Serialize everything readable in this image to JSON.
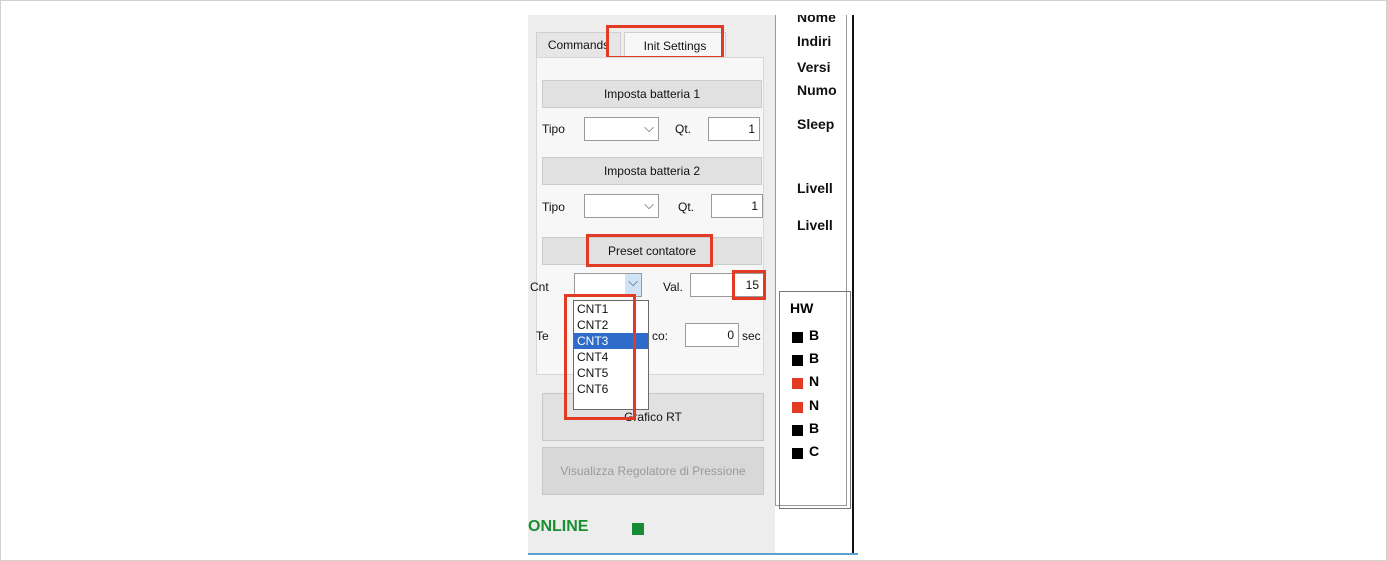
{
  "tabs": {
    "commands": "Commands",
    "init_settings": "Init Settings"
  },
  "battery1": {
    "button": "Imposta batteria 1",
    "tipo_label": "Tipo",
    "qt_label": "Qt.",
    "qt_value": "1"
  },
  "battery2": {
    "button": "Imposta batteria 2",
    "tipo_label": "Tipo",
    "qt_label": "Qt.",
    "qt_value": "1"
  },
  "preset": {
    "button": "Preset contatore",
    "cnt_label": "Cnt",
    "val_label": "Val.",
    "val_value": "15"
  },
  "dropdown": {
    "options": [
      "CNT1",
      "CNT2",
      "CNT3",
      "CNT4",
      "CNT5",
      "CNT6"
    ],
    "selected": "CNT3"
  },
  "timer": {
    "label_left": "Te",
    "label_right": "co:",
    "value": "0",
    "unit": "sec"
  },
  "buttons": {
    "grafico": "Grafico RT",
    "regolatore": "Visualizza Regolatore di Pressione"
  },
  "status": {
    "text": "ONLINE",
    "led_color": "#168b33"
  },
  "right": {
    "labels": [
      "Nome",
      "Indiri",
      "Versi",
      "Numo",
      "Sleep",
      "Livell",
      "Livell"
    ],
    "hw_label": "HW",
    "hw_rows": [
      {
        "letter": "B",
        "color": "#000000"
      },
      {
        "letter": "B",
        "color": "#000000"
      },
      {
        "letter": "N",
        "color": "#e23b25"
      },
      {
        "letter": "N",
        "color": "#e23b25"
      },
      {
        "letter": "B",
        "color": "#000000"
      },
      {
        "letter": "C",
        "color": "#000000"
      }
    ]
  },
  "highlight_color": "#e23b25"
}
